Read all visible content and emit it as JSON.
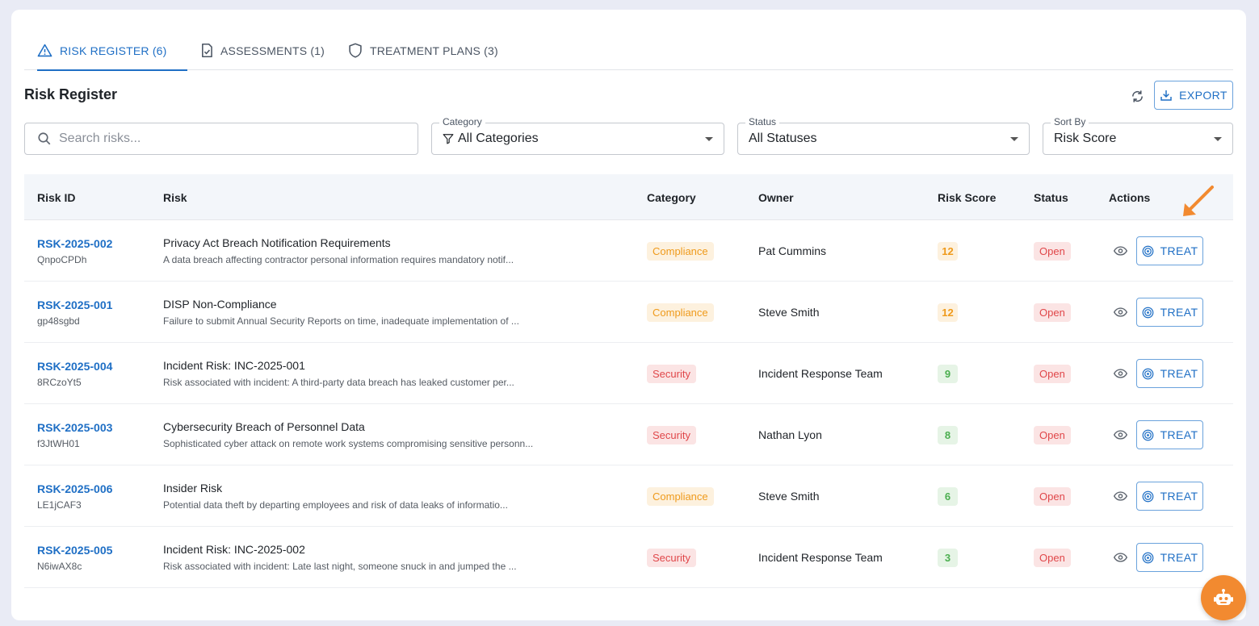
{
  "tabs": [
    {
      "label": "RISK REGISTER (6)",
      "icon": "warning-icon",
      "active": true
    },
    {
      "label": "ASSESSMENTS (1)",
      "icon": "clipboard-check-icon",
      "active": false
    },
    {
      "label": "TREATMENT PLANS (3)",
      "icon": "shield-icon",
      "active": false
    }
  ],
  "header": {
    "title": "Risk Register",
    "export_label": "EXPORT"
  },
  "filters": {
    "search_placeholder": "Search risks...",
    "category": {
      "label": "Category",
      "value": "All Categories"
    },
    "status": {
      "label": "Status",
      "value": "All Statuses"
    },
    "sort": {
      "label": "Sort By",
      "value": "Risk Score"
    }
  },
  "table": {
    "columns": [
      "Risk ID",
      "Risk",
      "Category",
      "Owner",
      "Risk Score",
      "Status",
      "Actions"
    ],
    "action_label": "TREAT",
    "rows": [
      {
        "id": "RSK-2025-002",
        "code": "QnpoCPDh",
        "title": "Privacy Act Breach Notification Requirements",
        "desc": "A data breach affecting contractor personal information requires mandatory notif...",
        "category": "Compliance",
        "owner": "Pat Cummins",
        "score": "12",
        "status": "Open"
      },
      {
        "id": "RSK-2025-001",
        "code": "gp48sgbd",
        "title": "DISP Non-Compliance",
        "desc": "Failure to submit Annual Security Reports on time, inadequate implementation of ...",
        "category": "Compliance",
        "owner": "Steve Smith",
        "score": "12",
        "status": "Open"
      },
      {
        "id": "RSK-2025-004",
        "code": "8RCzoYt5",
        "title": "Incident Risk: INC-2025-001",
        "desc": "Risk associated with incident: A third-party data breach has leaked customer per...",
        "category": "Security",
        "owner": "Incident Response Team",
        "score": "9",
        "status": "Open"
      },
      {
        "id": "RSK-2025-003",
        "code": "f3JtWH01",
        "title": "Cybersecurity Breach of Personnel Data",
        "desc": "Sophisticated cyber attack on remote work systems compromising sensitive personn...",
        "category": "Security",
        "owner": "Nathan Lyon",
        "score": "8",
        "status": "Open"
      },
      {
        "id": "RSK-2025-006",
        "code": "LE1jCAF3",
        "title": "Insider Risk",
        "desc": "Potential data theft by departing employees and risk of data leaks of informatio...",
        "category": "Compliance",
        "owner": "Steve Smith",
        "score": "6",
        "status": "Open"
      },
      {
        "id": "RSK-2025-005",
        "code": "N6iwAX8c",
        "title": "Incident Risk: INC-2025-002",
        "desc": "Risk associated with incident: Late last night, someone snuck in and jumped the ...",
        "category": "Security",
        "owner": "Incident Response Team",
        "score": "3",
        "status": "Open"
      }
    ]
  },
  "colors": {
    "accent": "#1f6fc5",
    "compliance": "#ef9a1b",
    "security": "#e0474a",
    "score_green": "#4caf50",
    "fab": "#f28a30"
  }
}
